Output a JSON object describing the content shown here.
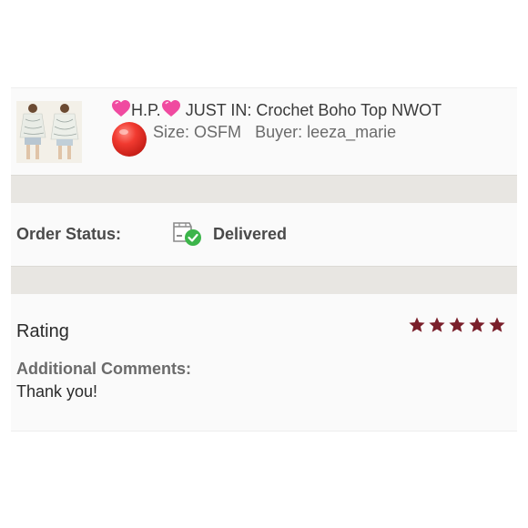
{
  "listing": {
    "title_prefix": "H.P.",
    "title_text": "JUST IN: Crochet Boho Top NWOT",
    "size_label": "Size:",
    "size_value": "OSFM",
    "buyer_label": "Buyer:",
    "buyer_value": "leeza_marie",
    "heart_icon": "pink-heart-emoji",
    "badge_icon": "red-circle-emoji"
  },
  "order": {
    "status_label": "Order Status:",
    "status_value": "Delivered",
    "status_icon": "box-check-icon",
    "check_color": "#3cb54a"
  },
  "review": {
    "rating_label": "Rating",
    "rating_value": 5,
    "rating_max": 5,
    "star_color": "#7a1f2b",
    "comments_label": "Additional Comments:",
    "comments_text": "Thank you!"
  }
}
